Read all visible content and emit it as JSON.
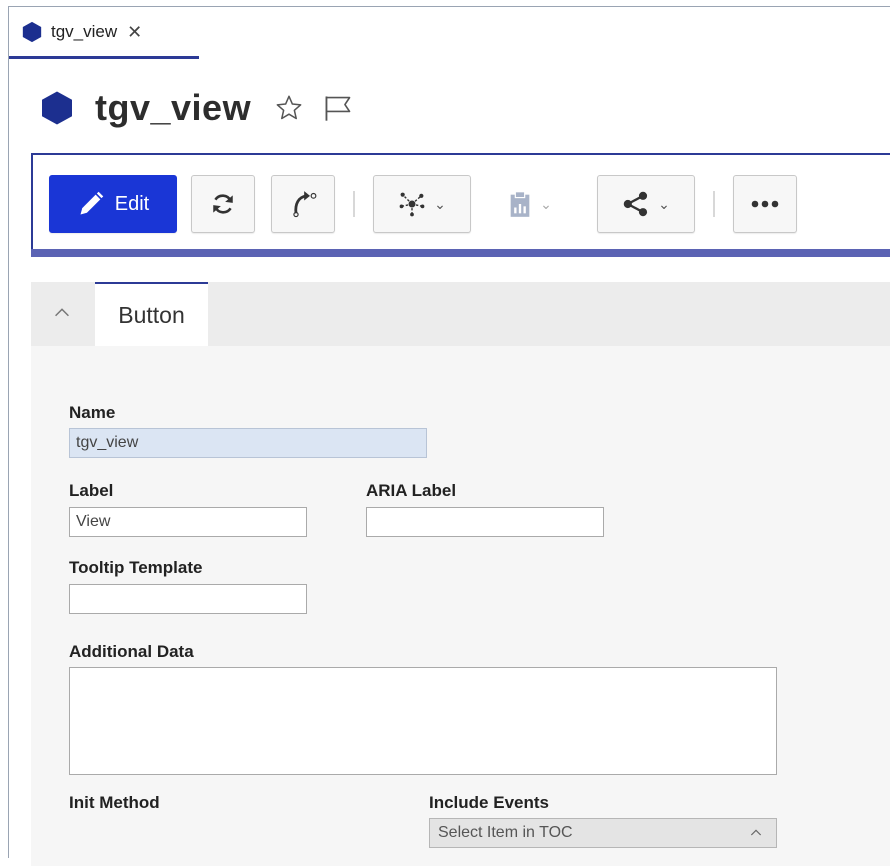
{
  "tab": {
    "label": "tgv_view",
    "close": "✕"
  },
  "header": {
    "title": "tgv_view"
  },
  "toolbar": {
    "edit_label": "Edit"
  },
  "section": {
    "tab_label": "Button"
  },
  "form": {
    "name_label": "Name",
    "name_value": "tgv_view",
    "label_label": "Label",
    "label_value": "View",
    "aria_label_label": "ARIA Label",
    "aria_label_value": "",
    "tooltip_label": "Tooltip Template",
    "tooltip_value": "",
    "additional_data_label": "Additional Data",
    "init_method_label": "Init Method",
    "include_events_label": "Include Events",
    "include_events_value": "Select Item in TOC"
  },
  "colors": {
    "accent": "#2c3a96",
    "edit_button": "#1a36d6",
    "hex_icon": "#1c2f8f",
    "readonly_field": "#dbe5f3"
  }
}
